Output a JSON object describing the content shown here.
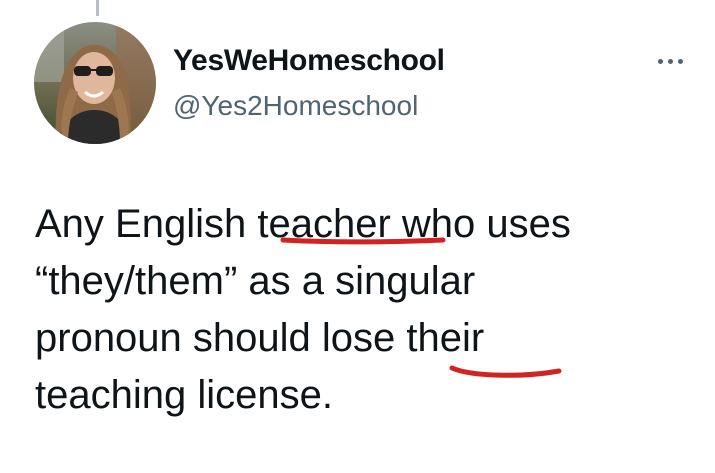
{
  "tweet": {
    "display_name": "YesWeHomeschool",
    "handle": "@Yes2Homeschool",
    "more_icon": "more-horizontal-icon",
    "text_lines": [
      "Any English teacher who uses",
      "“they/them” as a singular",
      "pronoun should lose their",
      "teaching license."
    ]
  },
  "annotations": {
    "underline_color": "#d32222",
    "underlined_words": [
      "teacher",
      "their"
    ]
  },
  "colors": {
    "text": "#0f1419",
    "secondary_text": "#536471"
  }
}
